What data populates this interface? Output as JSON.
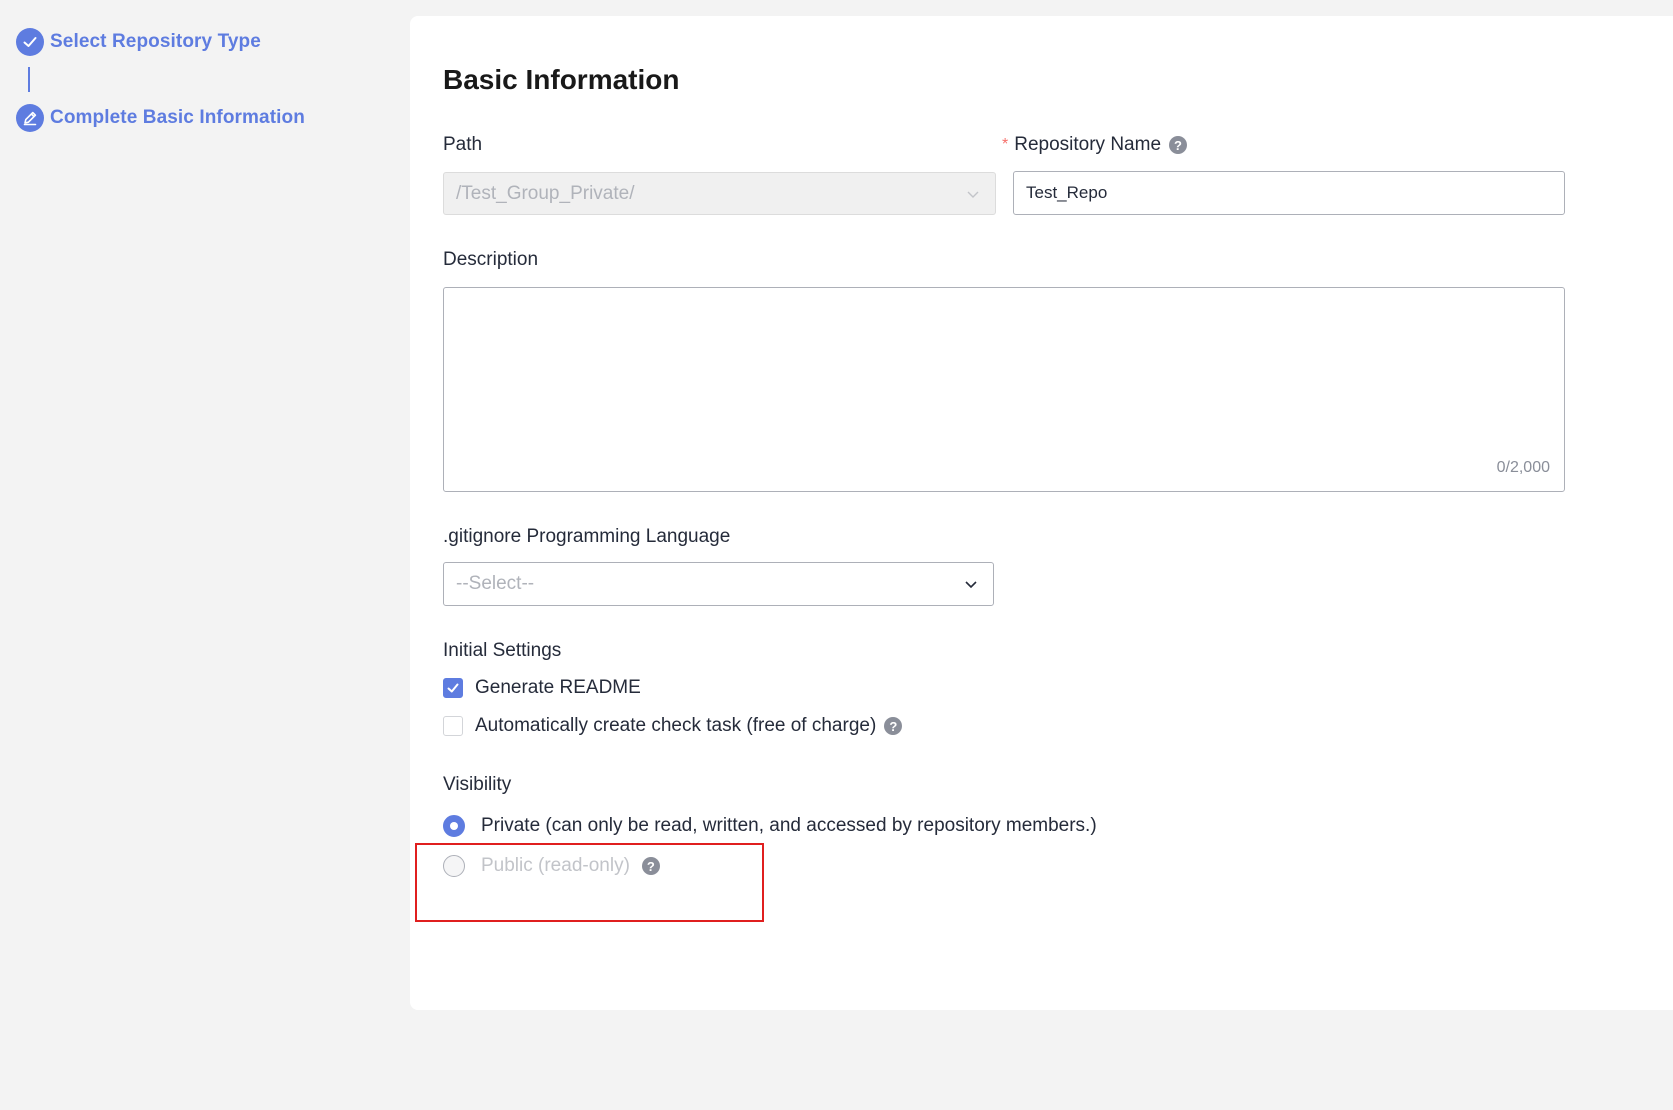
{
  "stepper": {
    "steps": [
      {
        "label": "Select Repository Type",
        "icon": "check-icon",
        "state": "completed"
      },
      {
        "label": "Complete Basic Information",
        "icon": "edit-icon",
        "state": "active"
      }
    ]
  },
  "form": {
    "title": "Basic Information",
    "path": {
      "label": "Path",
      "value": "/Test_Group_Private/"
    },
    "repository_name": {
      "label": "Repository Name",
      "required_mark": "*",
      "value": "Test_Repo"
    },
    "description": {
      "label": "Description",
      "value": "",
      "counter": "0/2,000"
    },
    "gitignore": {
      "label": ".gitignore Programming Language",
      "placeholder": "--Select--"
    },
    "initial_settings": {
      "label": "Initial Settings",
      "options": [
        {
          "label": "Generate README",
          "checked": true
        },
        {
          "label": "Automatically create check task (free of charge)",
          "checked": false
        }
      ]
    },
    "visibility": {
      "label": "Visibility",
      "options": [
        {
          "label": "Private (can only be read, written, and accessed by repository members.)",
          "selected": true,
          "disabled": false
        },
        {
          "label": "Public (read-only)",
          "selected": false,
          "disabled": true
        }
      ]
    },
    "help_icon_glyph": "?"
  },
  "colors": {
    "accent": "#5e7ce0",
    "required": "#f66f6a",
    "highlight": "#e01f1f",
    "page_background": "#f3f3f3"
  }
}
